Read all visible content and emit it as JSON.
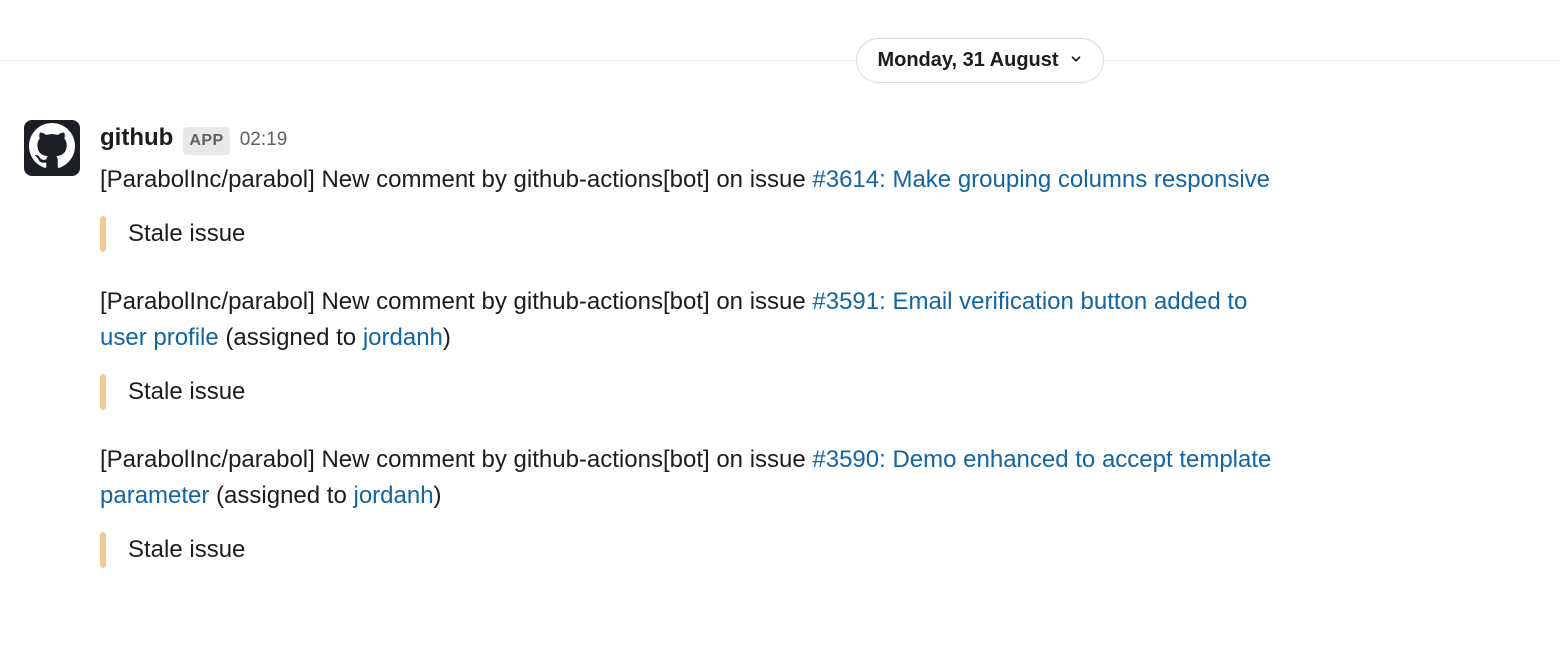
{
  "date_divider": {
    "label": "Monday, 31 August"
  },
  "message": {
    "sender": "github",
    "app_badge": "APP",
    "timestamp": "02:19",
    "notifications": [
      {
        "prefix": "[ParabolInc/parabol] New comment by github-actions[bot] on issue ",
        "issue_link": "#3614: Make grouping columns responsive",
        "assigned_prefix": "",
        "assignee": "",
        "assigned_suffix": "",
        "attachment": "Stale issue"
      },
      {
        "prefix": "[ParabolInc/parabol] New comment by github-actions[bot] on issue ",
        "issue_link": "#3591: Email verification button added to user profile",
        "assigned_prefix": " (assigned to ",
        "assignee": "jordanh",
        "assigned_suffix": ")",
        "attachment": "Stale issue"
      },
      {
        "prefix": "[ParabolInc/parabol] New comment by github-actions[bot] on issue ",
        "issue_link": "#3590: Demo enhanced to accept template parameter",
        "assigned_prefix": " (assigned to ",
        "assignee": "jordanh",
        "assigned_suffix": ")",
        "attachment": "Stale issue"
      }
    ]
  }
}
